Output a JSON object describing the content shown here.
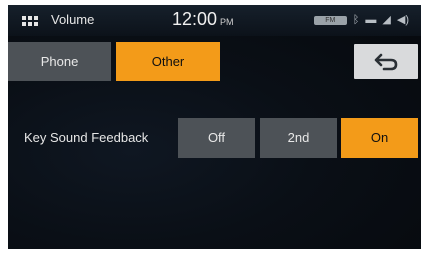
{
  "header": {
    "title": "Volume",
    "time": "12:00",
    "ampm": "PM",
    "battery_label": "FM",
    "status_icons": [
      "battery-icon",
      "bluetooth-icon",
      "mobile-icon",
      "signal-icon",
      "speaker-icon"
    ]
  },
  "tabs": [
    {
      "label": "Phone",
      "selected": false
    },
    {
      "label": "Other",
      "selected": true
    }
  ],
  "back_button": {
    "icon": "back-arrow-icon"
  },
  "setting": {
    "label": "Key Sound Feedback",
    "options": [
      "Off",
      "2nd",
      "On"
    ],
    "selected": "On"
  },
  "colors": {
    "accent": "#f39b19",
    "button_gray": "#4d5257",
    "back_button_bg": "#d9dadc",
    "background": "#0a0f16"
  }
}
